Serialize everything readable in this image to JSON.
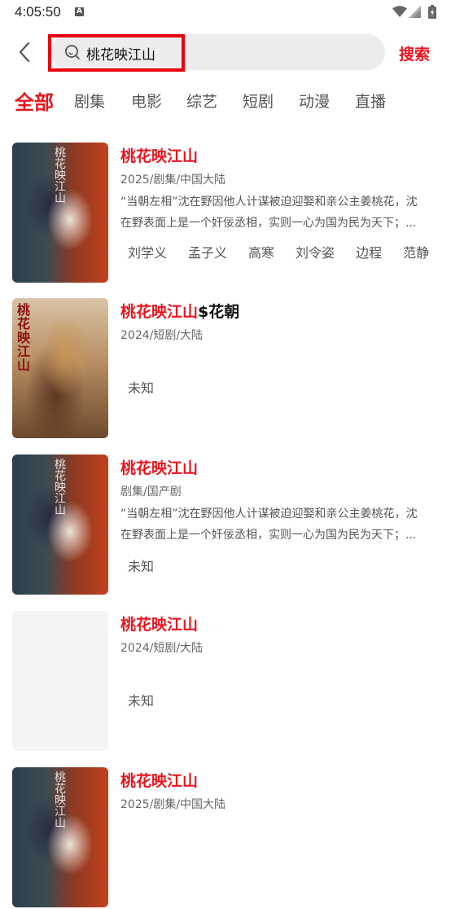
{
  "status_bar": {
    "time": "4:05:50",
    "notification_badge": "A",
    "icons": [
      "wifi-icon",
      "signal-icon",
      "battery-icon"
    ]
  },
  "header": {
    "back_icon": "chevron-left-icon",
    "search_icon": "search-icon",
    "search_query": "桃花映江山",
    "search_action": "搜索"
  },
  "colors": {
    "accent": "#e8151e",
    "highlight_box": "#e8000f",
    "search_bg": "#ececec"
  },
  "tabs": [
    {
      "label": "全部",
      "active": true
    },
    {
      "label": "剧集",
      "active": false
    },
    {
      "label": "电影",
      "active": false
    },
    {
      "label": "综艺",
      "active": false
    },
    {
      "label": "短剧",
      "active": false
    },
    {
      "label": "动漫",
      "active": false
    },
    {
      "label": "直播",
      "active": false
    }
  ],
  "results": [
    {
      "title": "桃花映江山",
      "title_suffix": "",
      "meta": "2025/剧集/中国大陆",
      "desc_line1": "“当朝左相”沈在野因他人计谋被迫迎娶和亲公主姜桃花，沈",
      "desc_line2": "在野表面上是一个奸佞丞相，实则一心为国为民为天下；...",
      "cast": [
        "刘学义",
        "孟子义",
        "高寒",
        "刘令姿",
        "边程",
        "范静"
      ],
      "unknown": "",
      "poster_text": "桃花映江山"
    },
    {
      "title": "桃花映江山",
      "title_suffix": "$花朝",
      "meta": "2024/短剧/大陆",
      "desc_line1": "",
      "desc_line2": "",
      "cast": [],
      "unknown": "未知",
      "poster_text": "桃花映江山"
    },
    {
      "title": "桃花映江山",
      "title_suffix": "",
      "meta": "剧集/国产剧",
      "desc_line1": "“当朝左相”沈在野因他人计谋被迫迎娶和亲公主姜桃花，沈",
      "desc_line2": "在野表面上是一个奸佞丞相，实则一心为国为民为天下；...",
      "cast": [],
      "unknown": "未知",
      "poster_text": "桃花映江山"
    },
    {
      "title": "桃花映江山",
      "title_suffix": "",
      "meta": "2024/短剧/大陆",
      "desc_line1": "",
      "desc_line2": "",
      "cast": [],
      "unknown": "未知",
      "poster_text": ""
    },
    {
      "title": "桃花映江山",
      "title_suffix": "",
      "meta": "2025/剧集/中国大陆",
      "desc_line1": "",
      "desc_line2": "",
      "cast": [],
      "unknown": "",
      "poster_text": "桃花映江山"
    }
  ]
}
